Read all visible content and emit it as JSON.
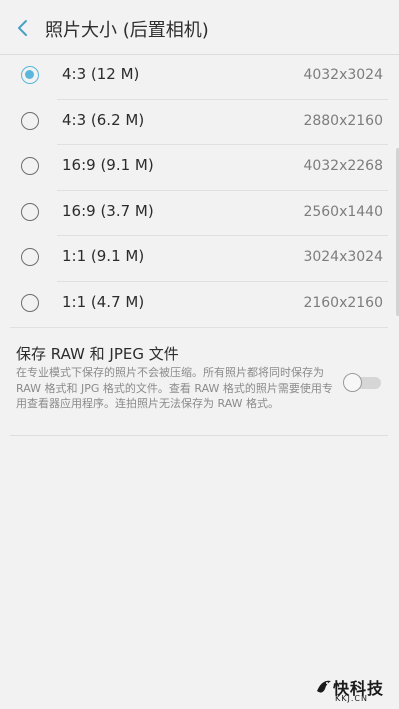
{
  "header": {
    "title": "照片大小 (后置相机)",
    "back_icon": "chevron-left-icon"
  },
  "accent_color": "#5ab7db",
  "options": [
    {
      "label": "4:3 (12 M)",
      "resolution": "4032x3024",
      "selected": true
    },
    {
      "label": "4:3 (6.2 M)",
      "resolution": "2880x2160",
      "selected": false
    },
    {
      "label": "16:9 (9.1 M)",
      "resolution": "4032x2268",
      "selected": false
    },
    {
      "label": "16:9 (3.7 M)",
      "resolution": "2560x1440",
      "selected": false
    },
    {
      "label": "1:1 (9.1 M)",
      "resolution": "3024x3024",
      "selected": false
    },
    {
      "label": "1:1 (4.7 M)",
      "resolution": "2160x2160",
      "selected": false
    }
  ],
  "raw_setting": {
    "title": "保存 RAW 和 JPEG 文件",
    "description": "在专业模式下保存的照片不会被压缩。所有照片都将同时保存为 RAW 格式和 JPG 格式的文件。查看 RAW 格式的照片需要使用专用查看器应用程序。连拍照片无法保存为 RAW 格式。",
    "enabled": false
  },
  "watermark": {
    "text": "快科技",
    "subtext": "KKJ.CN"
  }
}
